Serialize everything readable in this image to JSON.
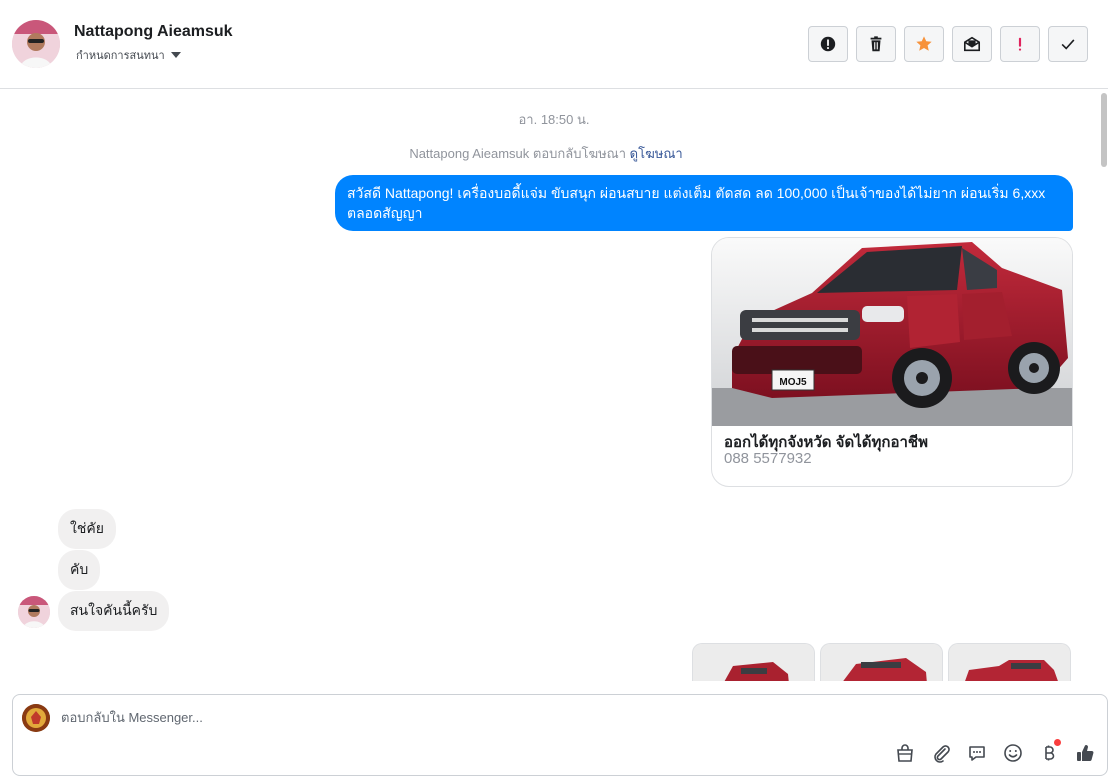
{
  "header": {
    "contact_name": "Nattapong Aieamsuk",
    "assign_label": "กำหนดการสนทนา"
  },
  "toolbar": {
    "icons": [
      "alert-circle-icon",
      "trash-icon",
      "star-icon",
      "mark-unread-icon",
      "important-icon",
      "check-icon"
    ],
    "colors": {
      "star": "#f7923b",
      "important": "#e0245e",
      "default": "#1c1e21"
    }
  },
  "thread": {
    "timestamp": "อา. 18:50 น.",
    "reply_note": {
      "text": "Nattapong Aieamsuk ตอบกลับโฆษณา",
      "link": "ดูโฆษณา"
    },
    "outgoing_message": "สวัสดี Nattapong! เครื่องบอดี้แจ่ม ขับสนุก ผ่อนสบาย แต่งเต็ม ตัดสด ลด 100,000 เป็นเจ้าของได้ไม่ยาก ผ่อนเริ่ม 6,xxx ตลอดสัญญา",
    "ad_card": {
      "plate": "MOJ5",
      "title": "ออกได้ทุกจังหวัด จัดได้ทุกอาชีพ",
      "subtitle": "088 5577932"
    },
    "incoming_messages": [
      {
        "text": "ใช่คัย"
      },
      {
        "text": "คับ"
      },
      {
        "text": "สนใจคันนี้ครับ"
      }
    ]
  },
  "composer": {
    "placeholder": "ตอบกลับใน Messenger...",
    "icons": [
      "shop-bag-icon",
      "paperclip-icon",
      "saved-reply-icon",
      "emoji-icon",
      "baht-payment-icon",
      "thumbs-up-icon"
    ]
  },
  "colors": {
    "brand_blue": "#0084ff",
    "incoming_bubble": "#f1f0f0",
    "link": "#385898",
    "muted": "#90949c"
  }
}
